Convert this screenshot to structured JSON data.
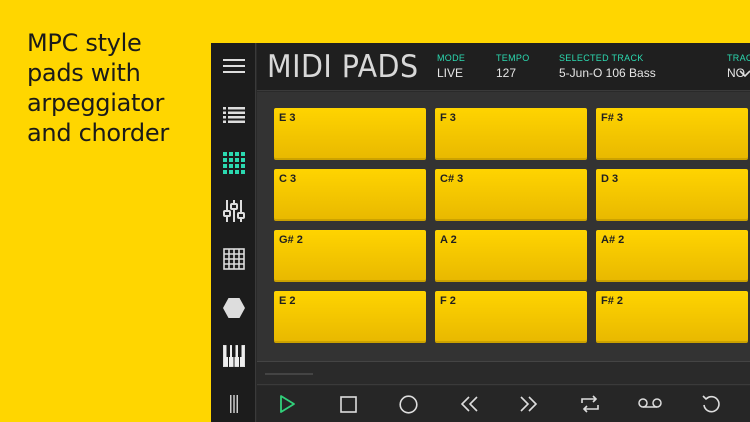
{
  "promo": {
    "text": "MPC style pads with arpeggiator and chorder"
  },
  "header": {
    "title": "MIDI PADS",
    "mode": {
      "label": "MODE",
      "value": "LIVE"
    },
    "tempo": {
      "label": "TEMPO",
      "value": "127"
    },
    "selected_track": {
      "label": "SELECTED TRACK",
      "value": "5-Jun-O 106 Bass"
    },
    "track_extra": {
      "label": "TRACK",
      "value": "NO"
    }
  },
  "pads": [
    [
      "E 3",
      "F 3",
      "F# 3"
    ],
    [
      "C 3",
      "C# 3",
      "D 3"
    ],
    [
      "G# 2",
      "A 2",
      "A# 2"
    ],
    [
      "E 2",
      "F 2",
      "F# 2"
    ]
  ],
  "sidenav": {
    "items": [
      "list-icon",
      "pads-icon",
      "mixer-icon",
      "grid-icon",
      "hexagon-icon",
      "piano-icon"
    ],
    "active": "pads-icon"
  },
  "transport": [
    "play-icon",
    "stop-icon",
    "record-icon",
    "rewind-icon",
    "fast-forward-icon",
    "loop-icon",
    "tape-icon",
    "undo-icon"
  ],
  "colors": {
    "accent": "#2bd9b0",
    "pad": "#FFD400",
    "background": "#FFD600",
    "play": "#31d07a"
  }
}
